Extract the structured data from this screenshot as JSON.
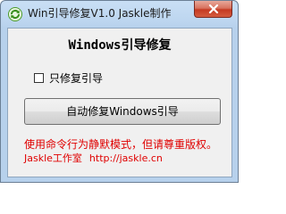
{
  "window": {
    "title": "Win引导修复V1.0   Jaskle制作"
  },
  "main": {
    "heading": "Windows引导修复",
    "checkbox_label": "只修复引导",
    "checkbox_checked": false,
    "repair_button_label": "自动修复Windows引导",
    "notice": "使用命令行为静默模式，但请尊重版权。",
    "credit_studio": "Jaskle工作室",
    "credit_url": "http://jaskle.cn"
  },
  "colors": {
    "notice_text": "#e00000",
    "titlebar": "#bcd5ef",
    "close_button": "#c53a22"
  },
  "icons": {
    "app": "green-refresh-icon",
    "close": "close-icon"
  }
}
